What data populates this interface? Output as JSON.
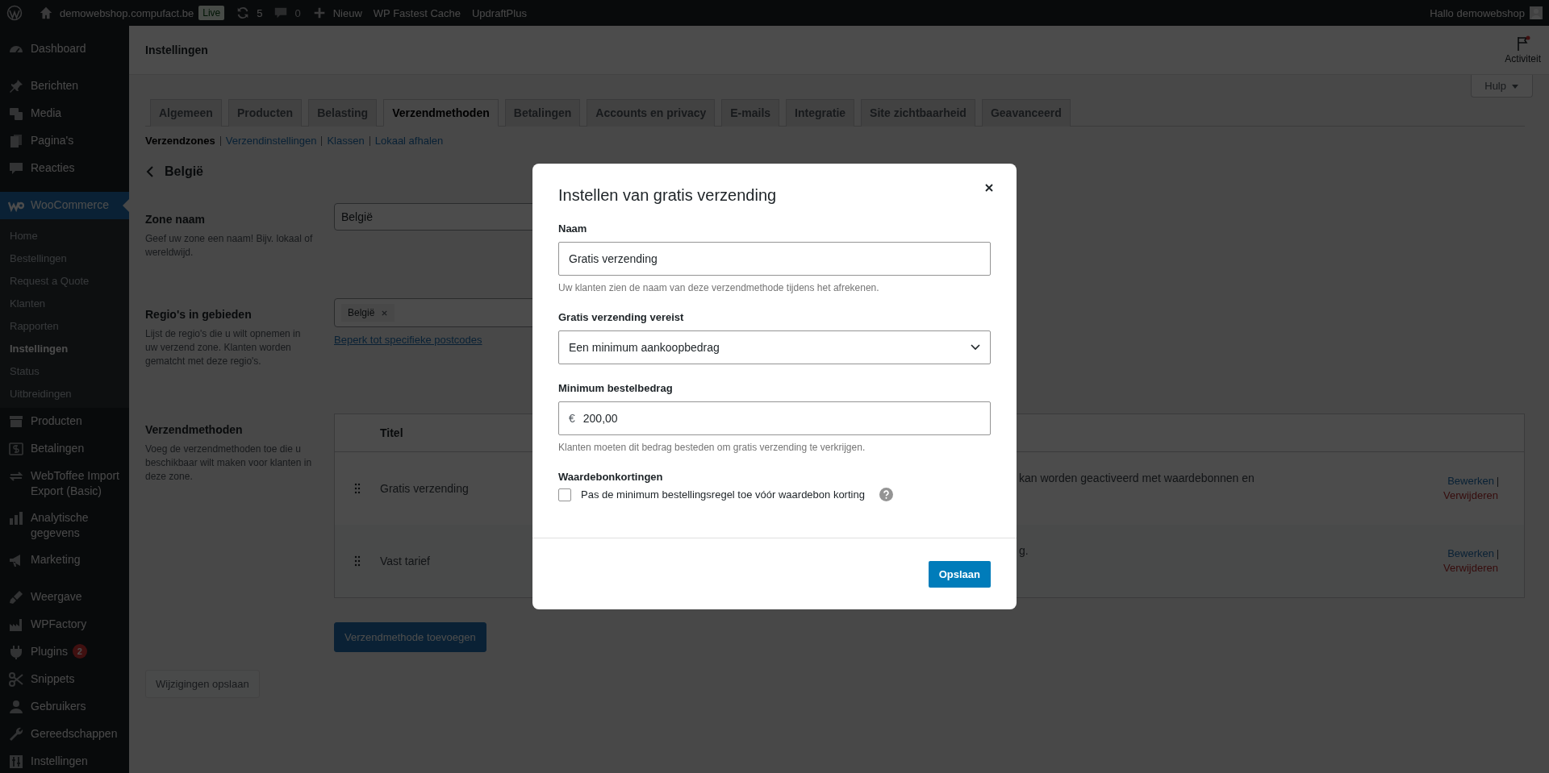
{
  "admin_bar": {
    "items": [
      {
        "kind": "logo"
      },
      {
        "kind": "site",
        "label": "demowebshop.compufact.be"
      },
      {
        "kind": "badge",
        "label": "Live"
      },
      {
        "kind": "updates",
        "label": "5"
      },
      {
        "kind": "comments",
        "label": "0"
      },
      {
        "kind": "new",
        "label": "Nieuw"
      },
      {
        "kind": "text",
        "label": "WP Fastest Cache"
      },
      {
        "kind": "text",
        "label": "UpdraftPlus"
      }
    ],
    "greeting": "Hallo demowebshop"
  },
  "sidebar": {
    "items": [
      {
        "label": "Dashboard",
        "selected": false
      },
      {
        "label": "Berichten",
        "selected": false
      },
      {
        "label": "Media",
        "selected": false
      },
      {
        "label": "Pagina's",
        "selected": false
      },
      {
        "label": "Reacties",
        "selected": false
      },
      {
        "label": "WooCommerce",
        "selected": true,
        "children": [
          {
            "label": "Home",
            "selected": false
          },
          {
            "label": "Bestellingen",
            "selected": false
          },
          {
            "label": "Request a Quote",
            "selected": false
          },
          {
            "label": "Klanten",
            "selected": false
          },
          {
            "label": "Rapporten",
            "selected": false
          },
          {
            "label": "Instellingen",
            "selected": true
          },
          {
            "label": "Status",
            "selected": false
          },
          {
            "label": "Uitbreidingen",
            "selected": false
          }
        ]
      },
      {
        "label": "Producten",
        "selected": false
      },
      {
        "label": "Betalingen",
        "selected": false
      },
      {
        "label": "WebToffee Import Export (Basic)",
        "selected": false
      },
      {
        "label": "Analytische gegevens",
        "selected": false
      },
      {
        "label": "Marketing",
        "selected": false
      },
      {
        "label": "Weergave",
        "selected": false
      },
      {
        "label": "WPFactory",
        "selected": false
      },
      {
        "label": "Plugins",
        "selected": false,
        "badge": "2"
      },
      {
        "label": "Snippets",
        "selected": false
      },
      {
        "label": "Gebruikers",
        "selected": false
      },
      {
        "label": "Gereedschappen",
        "selected": false
      },
      {
        "label": "Instellingen",
        "selected": false
      }
    ]
  },
  "header": {
    "title": "Instellingen",
    "activity": "Activiteit",
    "help": "Hulp"
  },
  "tabs": [
    {
      "label": "Algemeen",
      "selected": false
    },
    {
      "label": "Producten",
      "selected": false
    },
    {
      "label": "Belasting",
      "selected": false
    },
    {
      "label": "Verzendmethoden",
      "selected": true
    },
    {
      "label": "Betalingen",
      "selected": false
    },
    {
      "label": "Accounts en privacy",
      "selected": false
    },
    {
      "label": "E-mails",
      "selected": false
    },
    {
      "label": "Integratie",
      "selected": false
    },
    {
      "label": "Site zichtbaarheid",
      "selected": false
    },
    {
      "label": "Geavanceerd",
      "selected": false
    }
  ],
  "subnav": [
    {
      "label": "Verzendzones",
      "selected": true
    },
    {
      "label": "Verzendinstellingen",
      "selected": false
    },
    {
      "label": "Klassen",
      "selected": false
    },
    {
      "label": "Lokaal afhalen",
      "selected": false
    }
  ],
  "zone_title": "België",
  "zone": {
    "label": "Zone naam",
    "description": "Geef uw zone een naam! Bijv. lokaal of wereldwijd.",
    "value": "België"
  },
  "regions": {
    "label": "Regio's in gebieden",
    "description": "Lijst de regio's die u wilt opnemen in uw verzend zone. Klanten worden gematcht met deze regio's.",
    "tags": [
      "België"
    ],
    "link": "Beperk tot specifieke postcodes"
  },
  "methods": {
    "label": "Verzendmethoden",
    "description": "Voeg de verzendmethoden toe die u beschikbaar wilt maken voor klanten in deze zone.",
    "columns": [
      "Titel"
    ],
    "rows": [
      {
        "title": "Gratis verzending",
        "description": "kan worden geactiveerd met waardebonnen en",
        "actions": [
          "Bewerken",
          "Verwijderen"
        ]
      },
      {
        "title": "Vast tarief",
        "description": "g.",
        "actions": [
          "Bewerken",
          "Verwijderen"
        ]
      }
    ],
    "add_button": "Verzendmethode toevoegen"
  },
  "save_changes": {
    "label": "Wijzigingen opslaan",
    "disabled": true
  },
  "modal": {
    "title": "Instellen van gratis verzending",
    "fields": [
      {
        "kind": "text",
        "label": "Naam",
        "value": "Gratis verzending",
        "help": "Uw klanten zien de naam van deze verzendmethode tijdens het afrekenen."
      },
      {
        "kind": "select",
        "label": "Gratis verzending vereist",
        "value": "Een minimum aankoopbedrag"
      },
      {
        "kind": "price",
        "label": "Minimum bestelbedrag",
        "prefix": "€",
        "value": "200,00",
        "help": "Klanten moeten dit bedrag besteden om gratis verzending te verkrijgen."
      },
      {
        "kind": "checkbox",
        "label": "Waardebonkortingen",
        "option": "Pas de minimum bestellingsregel toe vóór waardebon korting",
        "checked": false
      }
    ],
    "save": "Opslaan"
  }
}
